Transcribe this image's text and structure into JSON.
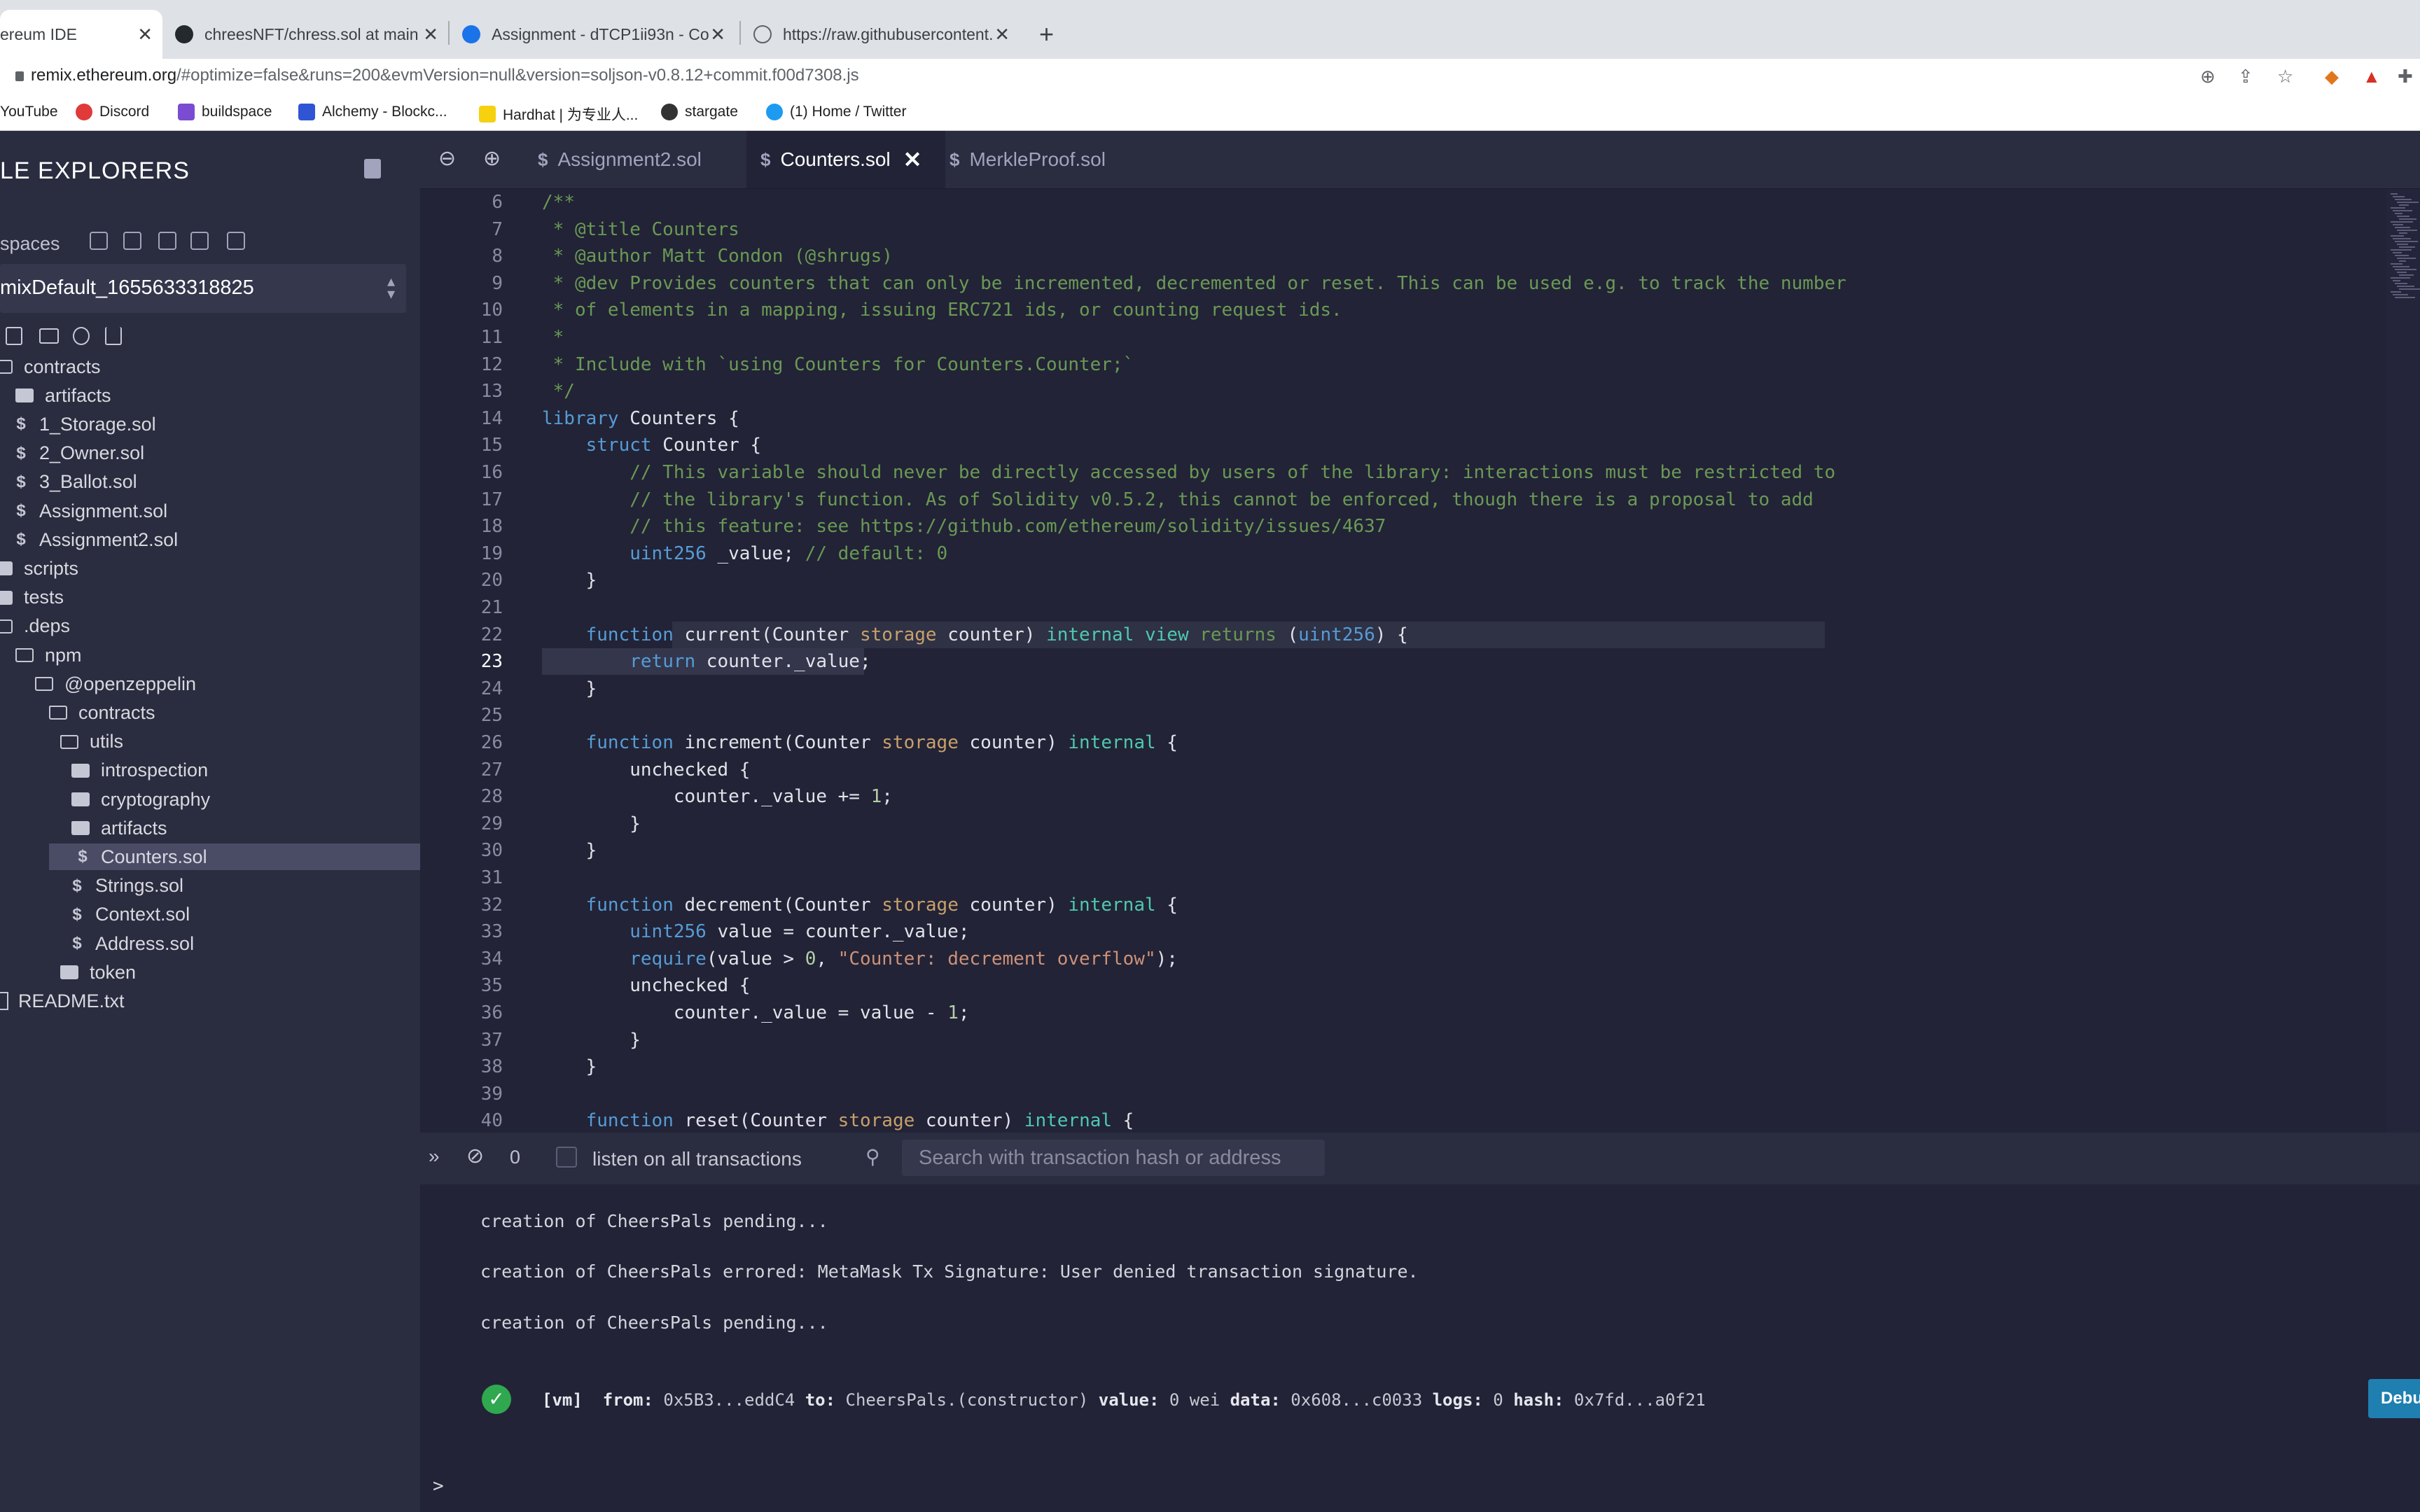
{
  "colors": {
    "keyword": "#569cd6",
    "type": "#4ec9b0",
    "comment": "#6a9955",
    "string": "#ce9178",
    "storage": "#c8a06b",
    "number": "#b5cea8",
    "text": "#e2e2ea"
  },
  "browser": {
    "tabs": [
      {
        "title": "ereum IDE",
        "icon": "remix-icon"
      },
      {
        "title": "chreesNFT/chress.sol at main",
        "icon": "github-icon"
      },
      {
        "title": "Assignment - dTCP1ii93n - Co",
        "icon": "google-classroom-icon"
      },
      {
        "title": "https://raw.githubusercontent.",
        "icon": "globe-icon"
      }
    ],
    "new_tab_label": "+",
    "url_host": "remix.ethereum.org",
    "url_rest": "/#optimize=false&runs=200&evmVersion=null&version=soljson-v0.8.12+commit.f00d7308.js",
    "bookmarks": [
      {
        "label": "YouTube"
      },
      {
        "label": "Discord"
      },
      {
        "label": "buildspace"
      },
      {
        "label": "Alchemy - Blockc..."
      },
      {
        "label": "Hardhat | 为专业人..."
      },
      {
        "label": "stargate"
      },
      {
        "label": "(1) Home / Twitter"
      }
    ]
  },
  "sidebar": {
    "title": "LE EXPLORERS",
    "workspaces_label": "spaces",
    "workspace_value": "mixDefault_1655633318825",
    "tree": [
      {
        "label": "contracts",
        "kind": "folder-open",
        "level": 0
      },
      {
        "label": "artifacts",
        "kind": "folder",
        "level": 1
      },
      {
        "label": "1_Storage.sol",
        "kind": "sol",
        "level": 1
      },
      {
        "label": "2_Owner.sol",
        "kind": "sol",
        "level": 1
      },
      {
        "label": "3_Ballot.sol",
        "kind": "sol",
        "level": 1
      },
      {
        "label": "Assignment.sol",
        "kind": "sol",
        "level": 1
      },
      {
        "label": "Assignment2.sol",
        "kind": "sol",
        "level": 1
      },
      {
        "label": "scripts",
        "kind": "folder",
        "level": 0
      },
      {
        "label": "tests",
        "kind": "folder",
        "level": 0
      },
      {
        "label": ".deps",
        "kind": "folder-open",
        "level": 0
      },
      {
        "label": "npm",
        "kind": "folder-open",
        "level": 1
      },
      {
        "label": "@openzeppelin",
        "kind": "folder-open",
        "level": 2
      },
      {
        "label": "contracts",
        "kind": "folder-open",
        "level": 3
      },
      {
        "label": "utils",
        "kind": "folder-open",
        "level": 4
      },
      {
        "label": "introspection",
        "kind": "folder",
        "level": 5
      },
      {
        "label": "cryptography",
        "kind": "folder",
        "level": 5
      },
      {
        "label": "artifacts",
        "kind": "folder",
        "level": 5
      },
      {
        "label": "Counters.sol",
        "kind": "sol",
        "level": 5,
        "selected": true
      },
      {
        "label": "Strings.sol",
        "kind": "sol",
        "level": 5
      },
      {
        "label": "Context.sol",
        "kind": "sol",
        "level": 5
      },
      {
        "label": "Address.sol",
        "kind": "sol",
        "level": 5
      },
      {
        "label": "token",
        "kind": "folder",
        "level": 4
      },
      {
        "label": "README.txt",
        "kind": "file",
        "level": 0
      }
    ]
  },
  "editor": {
    "tabs": [
      {
        "label": "Assignment2.sol",
        "active": false
      },
      {
        "label": "Counters.sol",
        "active": true
      },
      {
        "label": "MerkleProof.sol",
        "active": false
      }
    ],
    "current_line": 23,
    "lines": [
      {
        "n": "6",
        "t": [
          [
            "/**",
            "comment"
          ]
        ]
      },
      {
        "n": "7",
        "t": [
          [
            " * @title Counters",
            "comment"
          ]
        ]
      },
      {
        "n": "8",
        "t": [
          [
            " * @author Matt Condon (@shrugs)",
            "comment"
          ]
        ]
      },
      {
        "n": "9",
        "t": [
          [
            " * @dev Provides counters that can only be incremented, decremented or reset. This can be used e.g. to track the number",
            "comment"
          ]
        ]
      },
      {
        "n": "10",
        "t": [
          [
            " * of elements in a mapping, issuing ERC721 ids, or counting request ids.",
            "comment"
          ]
        ]
      },
      {
        "n": "11",
        "t": [
          [
            " *",
            "comment"
          ]
        ]
      },
      {
        "n": "12",
        "t": [
          [
            " * Include with `using Counters for Counters.Counter;`",
            "comment"
          ]
        ]
      },
      {
        "n": "13",
        "t": [
          [
            " */",
            "comment"
          ]
        ]
      },
      {
        "n": "14",
        "t": [
          [
            "library",
            "keyword"
          ],
          [
            " Counters {",
            "text"
          ]
        ]
      },
      {
        "n": "15",
        "t": [
          [
            "    ",
            "text"
          ],
          [
            "struct",
            "keyword"
          ],
          [
            " Counter {",
            "text"
          ]
        ]
      },
      {
        "n": "16",
        "t": [
          [
            "        // This variable should never be directly accessed by users of the library: interactions must be restricted to",
            "comment"
          ]
        ]
      },
      {
        "n": "17",
        "t": [
          [
            "        // the library's function. As of Solidity v0.5.2, this cannot be enforced, though there is a proposal to add",
            "comment"
          ]
        ]
      },
      {
        "n": "18",
        "t": [
          [
            "        // this feature: see https://github.com/ethereum/solidity/issues/4637",
            "comment"
          ]
        ]
      },
      {
        "n": "19",
        "t": [
          [
            "        ",
            "text"
          ],
          [
            "uint256",
            "keyword"
          ],
          [
            " _value; ",
            "text"
          ],
          [
            "// default: 0",
            "comment"
          ]
        ]
      },
      {
        "n": "20",
        "t": [
          [
            "    }",
            "text"
          ]
        ]
      },
      {
        "n": "21",
        "t": [
          [
            "",
            "text"
          ]
        ]
      },
      {
        "n": "22",
        "t": [
          [
            "    ",
            "text"
          ],
          [
            "function",
            "keyword"
          ],
          [
            " current(Counter ",
            "text"
          ],
          [
            "storage",
            "storage"
          ],
          [
            " counter) ",
            "text"
          ],
          [
            "internal",
            "type"
          ],
          [
            " ",
            "text"
          ],
          [
            "view",
            "type"
          ],
          [
            " ",
            "text"
          ],
          [
            "returns",
            "comment"
          ],
          [
            " (",
            "text"
          ],
          [
            "uint256",
            "keyword"
          ],
          [
            ") {",
            "text"
          ]
        ]
      },
      {
        "n": "23",
        "t": [
          [
            "        ",
            "text"
          ],
          [
            "return",
            "keyword"
          ],
          [
            " counter._value;",
            "text"
          ]
        ]
      },
      {
        "n": "24",
        "t": [
          [
            "    }",
            "text"
          ]
        ]
      },
      {
        "n": "25",
        "t": [
          [
            "",
            "text"
          ]
        ]
      },
      {
        "n": "26",
        "t": [
          [
            "    ",
            "text"
          ],
          [
            "function",
            "keyword"
          ],
          [
            " increment(Counter ",
            "text"
          ],
          [
            "storage",
            "storage"
          ],
          [
            " counter) ",
            "text"
          ],
          [
            "internal",
            "type"
          ],
          [
            " {",
            "text"
          ]
        ]
      },
      {
        "n": "27",
        "t": [
          [
            "        unchecked {",
            "text"
          ]
        ]
      },
      {
        "n": "28",
        "t": [
          [
            "            counter._value += ",
            "text"
          ],
          [
            "1",
            "number"
          ],
          [
            ";",
            "text"
          ]
        ]
      },
      {
        "n": "29",
        "t": [
          [
            "        }",
            "text"
          ]
        ]
      },
      {
        "n": "30",
        "t": [
          [
            "    }",
            "text"
          ]
        ]
      },
      {
        "n": "31",
        "t": [
          [
            "",
            "text"
          ]
        ]
      },
      {
        "n": "32",
        "t": [
          [
            "    ",
            "text"
          ],
          [
            "function",
            "keyword"
          ],
          [
            " decrement(Counter ",
            "text"
          ],
          [
            "storage",
            "storage"
          ],
          [
            " counter) ",
            "text"
          ],
          [
            "internal",
            "type"
          ],
          [
            " {",
            "text"
          ]
        ]
      },
      {
        "n": "33",
        "t": [
          [
            "        ",
            "text"
          ],
          [
            "uint256",
            "keyword"
          ],
          [
            " value = counter._value;",
            "text"
          ]
        ]
      },
      {
        "n": "34",
        "t": [
          [
            "        ",
            "text"
          ],
          [
            "require",
            "keyword"
          ],
          [
            "(value > ",
            "text"
          ],
          [
            "0",
            "number"
          ],
          [
            ", ",
            "text"
          ],
          [
            "\"Counter: decrement overflow\"",
            "string"
          ],
          [
            ");",
            "text"
          ]
        ]
      },
      {
        "n": "35",
        "t": [
          [
            "        unchecked {",
            "text"
          ]
        ]
      },
      {
        "n": "36",
        "t": [
          [
            "            counter._value = value - ",
            "text"
          ],
          [
            "1",
            "number"
          ],
          [
            ";",
            "text"
          ]
        ]
      },
      {
        "n": "37",
        "t": [
          [
            "        }",
            "text"
          ]
        ]
      },
      {
        "n": "38",
        "t": [
          [
            "    }",
            "text"
          ]
        ]
      },
      {
        "n": "39",
        "t": [
          [
            "",
            "text"
          ]
        ]
      },
      {
        "n": "40",
        "t": [
          [
            "    ",
            "text"
          ],
          [
            "function",
            "keyword"
          ],
          [
            " reset(Counter ",
            "text"
          ],
          [
            "storage",
            "storage"
          ],
          [
            " counter) ",
            "text"
          ],
          [
            "internal",
            "type"
          ],
          [
            " {",
            "text"
          ]
        ]
      }
    ]
  },
  "terminal": {
    "pending_count": "0",
    "listen_label": "listen on all transactions",
    "search_placeholder": "Search with transaction hash or address",
    "messages": [
      "creation of CheersPals pending...",
      "creation of CheersPals errored: MetaMask Tx Signature: User denied transaction signature.",
      "creation of CheersPals pending..."
    ],
    "tx_line": [
      [
        "[vm]",
        "label"
      ],
      [
        "  ",
        "v"
      ],
      [
        "from:",
        "label"
      ],
      [
        " 0x5B3...eddC4 ",
        "v"
      ],
      [
        "to:",
        "label"
      ],
      [
        " CheersPals.(constructor) ",
        "v"
      ],
      [
        "value:",
        "label"
      ],
      [
        " 0 wei ",
        "v"
      ],
      [
        "data:",
        "label"
      ],
      [
        " 0x608...c0033 ",
        "v"
      ],
      [
        "logs:",
        "label"
      ],
      [
        " 0 ",
        "v"
      ],
      [
        "hash:",
        "label"
      ],
      [
        " 0x7fd...a0f21",
        "v"
      ]
    ],
    "debug_label": "Debug",
    "prompt": ">"
  }
}
